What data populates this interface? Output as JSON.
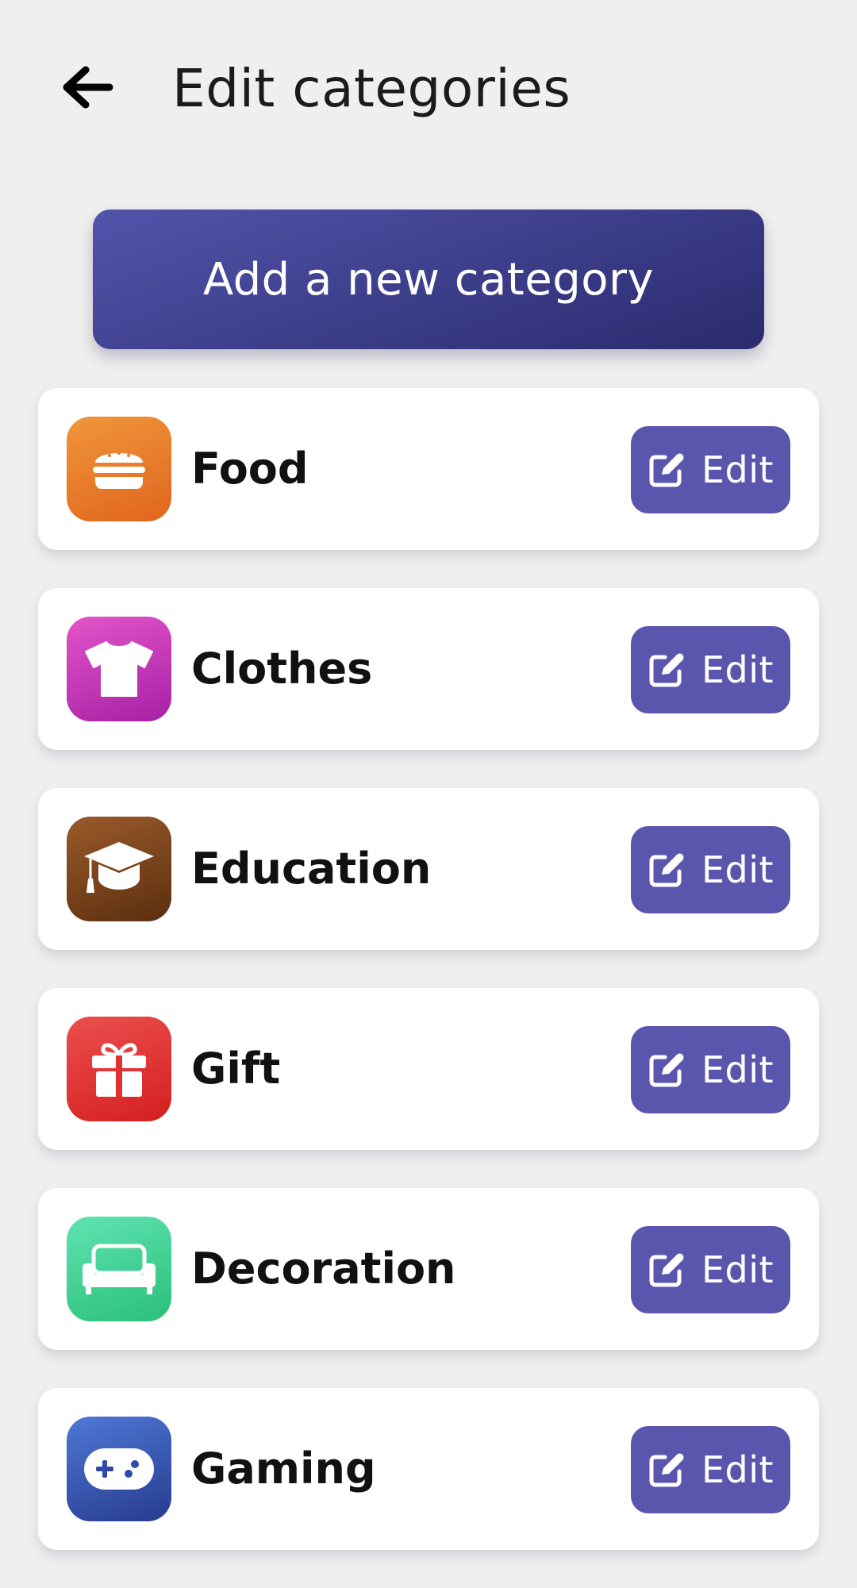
{
  "header": {
    "title": "Edit categories",
    "back_icon": "arrow-left-icon"
  },
  "add_button": {
    "label": "Add a new category"
  },
  "categories": [
    {
      "name": "Food",
      "icon": "hamburger-icon",
      "colors": [
        "#f0963a",
        "#e0651e"
      ],
      "edit_label": "Edit"
    },
    {
      "name": "Clothes",
      "icon": "tshirt-icon",
      "colors": [
        "#e454c9",
        "#a621a5"
      ],
      "edit_label": "Edit"
    },
    {
      "name": "Education",
      "icon": "graduation-cap-icon",
      "colors": [
        "#9a5a2a",
        "#5b2f0f"
      ],
      "edit_label": "Edit"
    },
    {
      "name": "Gift",
      "icon": "gift-icon",
      "colors": [
        "#ec4f4f",
        "#d41f1f"
      ],
      "edit_label": "Edit"
    },
    {
      "name": "Decoration",
      "icon": "sofa-icon",
      "colors": [
        "#5fe3b3",
        "#2bbf79"
      ],
      "edit_label": "Edit"
    },
    {
      "name": "Gaming",
      "icon": "gamepad-icon",
      "colors": [
        "#4f78d6",
        "#263c8e"
      ],
      "edit_label": "Edit"
    }
  ],
  "colors": {
    "accent": "#5a55ad",
    "background": "#efefef",
    "card": "#ffffff"
  }
}
